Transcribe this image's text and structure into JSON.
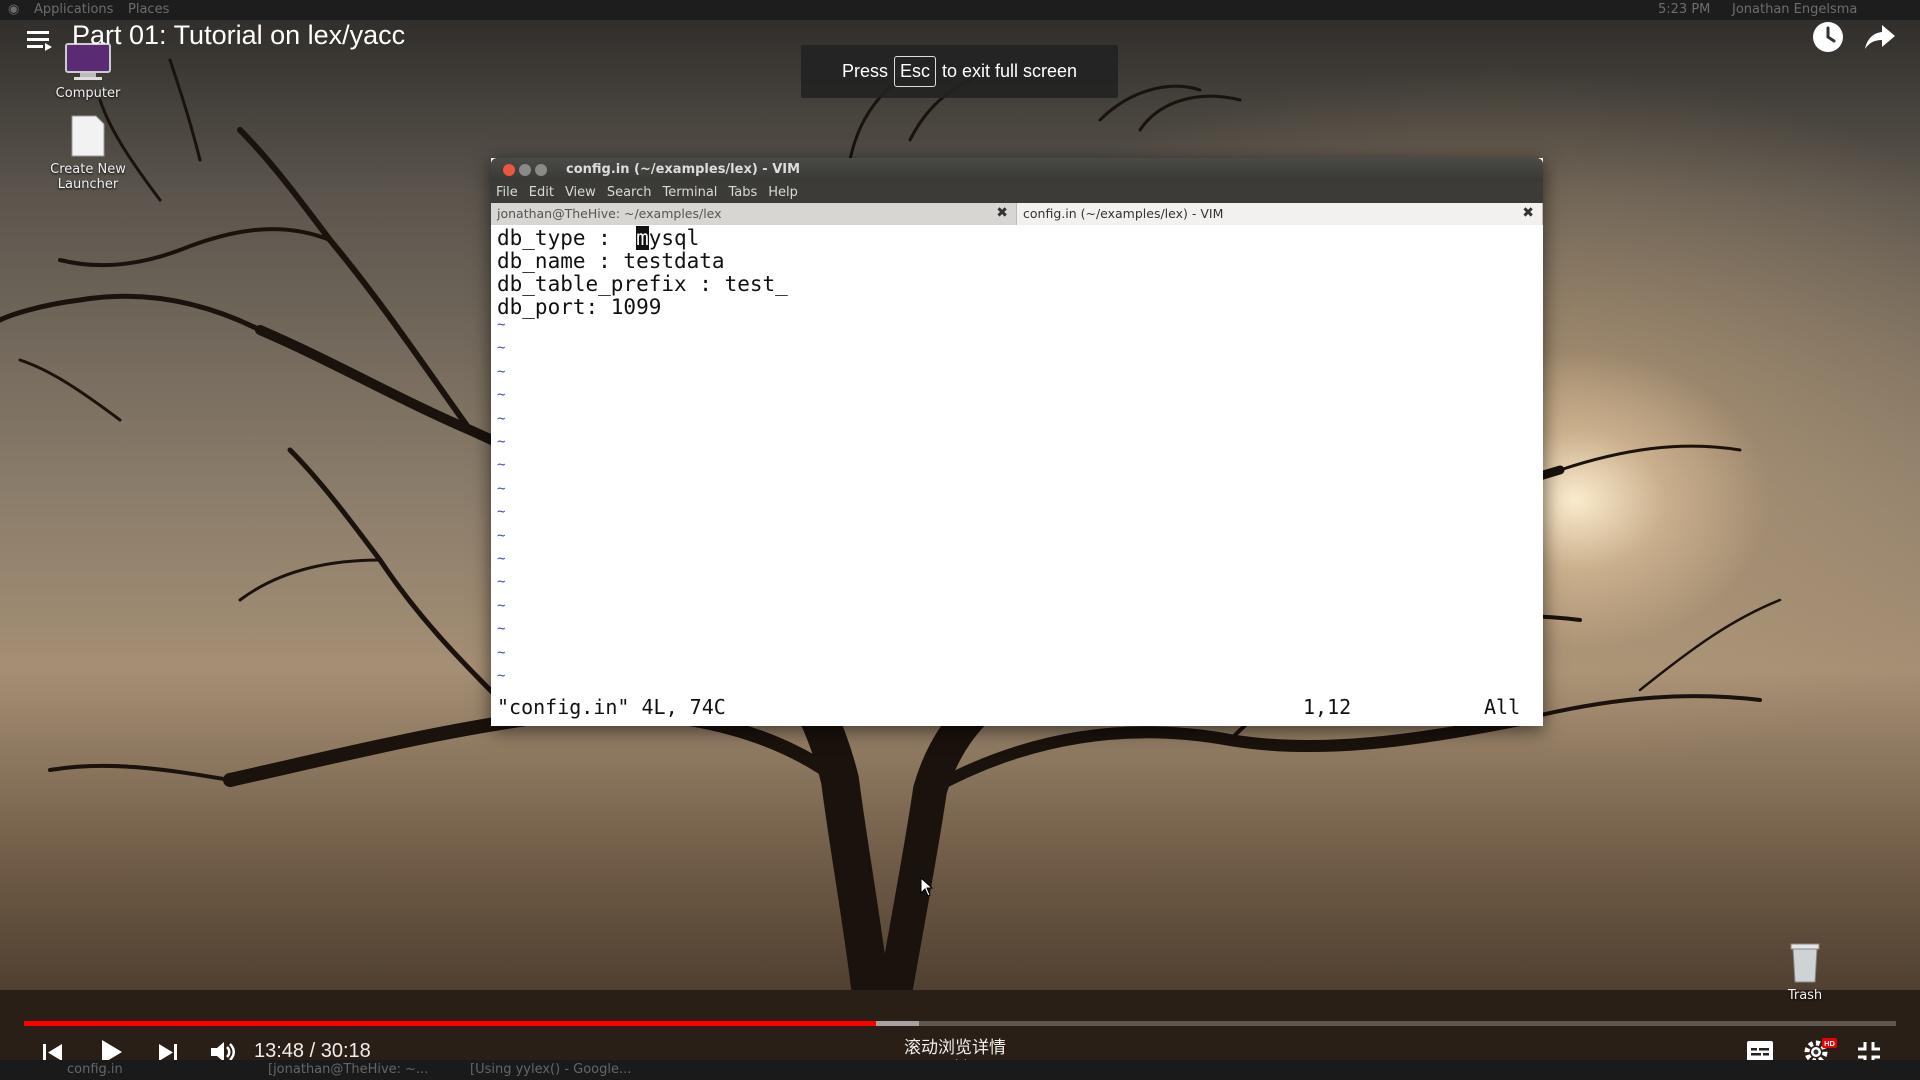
{
  "gnome_panel": {
    "applications": "Applications",
    "places": "Places",
    "clock": "5:23 PM",
    "user": "Jonathan Engelsma"
  },
  "video": {
    "title": "Part 01: Tutorial on lex/yacc",
    "esc_prefix": "Press",
    "esc_key": "Esc",
    "esc_suffix": "to exit full screen",
    "time_display": "13:48 / 30:18",
    "progress_fraction": 0.455,
    "buffered_fraction": 0.478,
    "scroll_hint": "滚动浏览详情"
  },
  "desktop": {
    "computer_label": "Computer",
    "launcher_label": "Create New\nLauncher",
    "trash_label": "Trash"
  },
  "window": {
    "title": "config.in (~/examples/lex) - VIM",
    "menu": [
      "File",
      "Edit",
      "View",
      "Search",
      "Terminal",
      "Tabs",
      "Help"
    ],
    "tab1": "jonathan@TheHive: ~/examples/lex",
    "tab2": "config.in (~/examples/lex) - VIM"
  },
  "vim": {
    "line1_prefix": "db_type :  ",
    "line1_cursor": "m",
    "line1_suffix": "ysql",
    "line2": "db_name : testdata",
    "line3": "db_table_prefix : test_",
    "line4": "db_port: 1099",
    "status_file": "\"config.in\" 4L, 74C",
    "status_pos": "1,12",
    "status_all": "All"
  },
  "taskbar": {
    "item1": "config.in",
    "item2": "[jonathan@TheHive: ~...",
    "item3": "[Using yylex() - Google..."
  }
}
